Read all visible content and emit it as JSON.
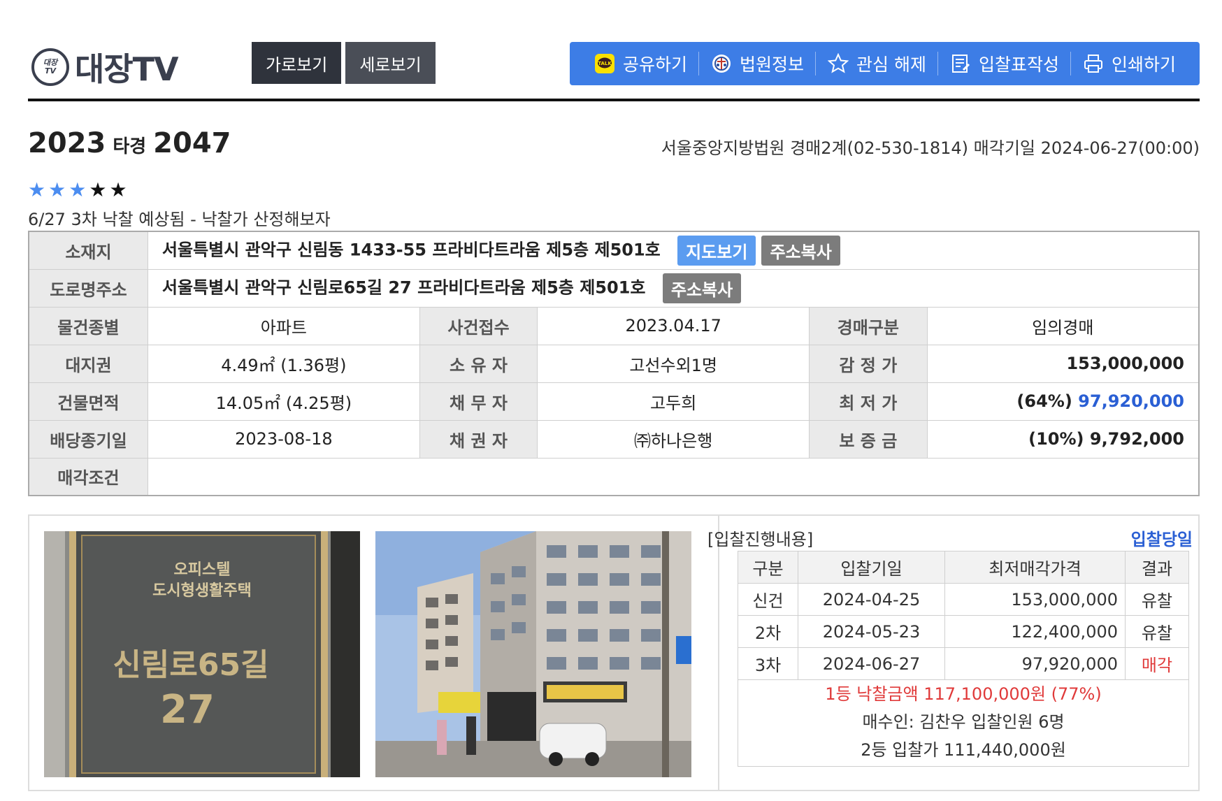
{
  "header": {
    "logo_mark_top": "대장",
    "logo_mark_bottom": "TV",
    "logo_text": "대장TV",
    "view_horizontal": "가로보기",
    "view_vertical": "세로보기",
    "tools": [
      {
        "label": "공유하기",
        "icon": "kakao-talk-icon"
      },
      {
        "label": "법원정보",
        "icon": "court-emblem-icon"
      },
      {
        "label": "관심 해제",
        "icon": "star-outline-icon"
      },
      {
        "label": "입찰표작성",
        "icon": "document-edit-icon"
      },
      {
        "label": "인쇄하기",
        "icon": "printer-icon"
      }
    ],
    "colors": {
      "toolbar": "#3d7de6",
      "view_btn": "#2f333c"
    }
  },
  "case": {
    "year": "2023",
    "type": "타경",
    "number": "2047",
    "court_info": "서울중앙지방법원 경매2계(02-530-1814) 매각기일 2024-06-27(00:00)",
    "stars_filled": 3,
    "stars_total": 5,
    "memo": "6/27 3차 낙찰 예상됨 - 낙찰가 산정해보자"
  },
  "info": {
    "location_label": "소재지",
    "location": "서울특별시 관악구 신림동 1433-55 프라비다트라움 제5층 제501호",
    "map_button": "지도보기",
    "copy_button": "주소복사",
    "road_label": "도로명주소",
    "road": "서울특별시 관악구 신림로65길 27 프라비다트라움 제5층 제501호",
    "type_label": "물건종별",
    "type": "아파트",
    "filed_label": "사건접수",
    "filed": "2023.04.17",
    "auction_kind_label": "경매구분",
    "auction_kind": "임의경매",
    "land_label": "대지권",
    "land": "4.49㎡ (1.36평)",
    "owner_label": "소 유 자",
    "owner": "고선수외1명",
    "appraisal_label": "감 정 가",
    "appraisal": "153,000,000",
    "building_label": "건물면적",
    "building": "14.05㎡ (4.25평)",
    "debtor_label": "채 무 자",
    "debtor": "고두희",
    "min_label": "최 저 가",
    "min_pct": "(64%)",
    "min_value": "97,920,000",
    "dividend_label": "배당종기일",
    "dividend": "2023-08-18",
    "creditor_label": "채 권 자",
    "creditor": "㈜하나은행",
    "deposit_label": "보 증 금",
    "deposit": "(10%) 9,792,000",
    "conditions_label": "매각조건",
    "conditions": ""
  },
  "photos": {
    "sign_line1": "오피스텔",
    "sign_line2": "도시형생활주택",
    "sign_street": "신림로65길",
    "sign_number": "27"
  },
  "bidding": {
    "title": "[입찰진행내용]",
    "today_link": "입찰당일",
    "headers": [
      "구분",
      "입찰기일",
      "최저매각가격",
      "결과"
    ],
    "rows": [
      {
        "round": "신건",
        "date": "2024-04-25",
        "price": "153,000,000",
        "result": "유찰"
      },
      {
        "round": "2차",
        "date": "2024-05-23",
        "price": "122,400,000",
        "result": "유찰"
      },
      {
        "round": "3차",
        "date": "2024-06-27",
        "price": "97,920,000",
        "result": "매각"
      }
    ],
    "winning": "1등 낙찰금액 117,100,000원 (77%)",
    "buyer": "매수인: 김찬우 입찰인원 6명",
    "second": "2등 입찰가 111,440,000원"
  }
}
